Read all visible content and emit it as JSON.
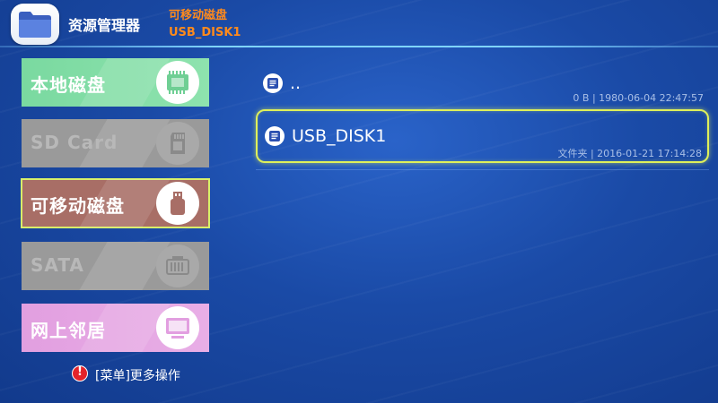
{
  "header": {
    "app_title": "资源管理器",
    "current_location": "可移动磁盘",
    "current_device": "USB_DISK1",
    "icon": "folder-icon"
  },
  "sidebar": {
    "items": [
      {
        "label": "本地磁盘",
        "icon": "chip-icon",
        "state": "enabled"
      },
      {
        "label": "SD Card",
        "icon": "sd-card-icon",
        "state": "disabled"
      },
      {
        "label": "可移动磁盘",
        "icon": "usb-drive-icon",
        "state": "selected"
      },
      {
        "label": "SATA",
        "icon": "sata-icon",
        "state": "disabled"
      },
      {
        "label": "网上邻居",
        "icon": "network-screen-icon",
        "state": "enabled"
      }
    ]
  },
  "hint": {
    "text": "[菜单]更多操作",
    "icon": "alert-icon"
  },
  "files": [
    {
      "name": "..",
      "meta": "0 B | 1980-06-04 22:47:57",
      "icon": "list-icon"
    },
    {
      "name": "USB_DISK1",
      "meta": "文件夹 | 2016-01-21 17:14:28",
      "icon": "list-icon",
      "selected": true
    }
  ],
  "colors": {
    "accent_orange": "#ff8a1c",
    "focus_yellow": "#dff05a",
    "background_blue": "#1a4aa6"
  }
}
